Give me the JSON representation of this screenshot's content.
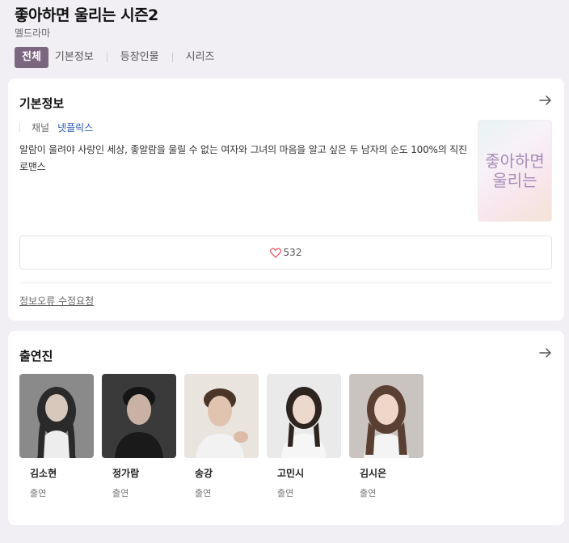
{
  "header": {
    "title": "좋아하면 울리는 시즌2",
    "genre": "멜드라마"
  },
  "tabs": [
    {
      "label": "전체",
      "active": true
    },
    {
      "label": "기본정보",
      "active": false
    },
    {
      "label": "등장인물",
      "active": false
    },
    {
      "label": "시리즈",
      "active": false
    }
  ],
  "info": {
    "section_title": "기본정보",
    "channel_label": "채널",
    "channel_value": "넷플릭스",
    "synopsis": "알람이 울려야 사랑인 세상, 좋알람을 울릴 수 없는 여자와 그녀의 마음을 알고 싶은 두 남자의 순도 100%의 직진 로맨스",
    "poster_text": "좋아하면 울리는",
    "likes": "532",
    "report_label": "정보오류 수정요청"
  },
  "cast": {
    "section_title": "출연진",
    "members": [
      {
        "name": "김소현",
        "role": "출연"
      },
      {
        "name": "정가람",
        "role": "출연"
      },
      {
        "name": "송강",
        "role": "출연"
      },
      {
        "name": "고민시",
        "role": "출연"
      },
      {
        "name": "김시은",
        "role": "출연"
      }
    ]
  },
  "colors": {
    "active_tab": "#7b667f",
    "link": "#2a5db0",
    "heart": "#e5485d",
    "poster_text": "#a88cb8"
  },
  "icons": {
    "arrow": "arrow-right-icon",
    "heart": "heart-icon"
  }
}
